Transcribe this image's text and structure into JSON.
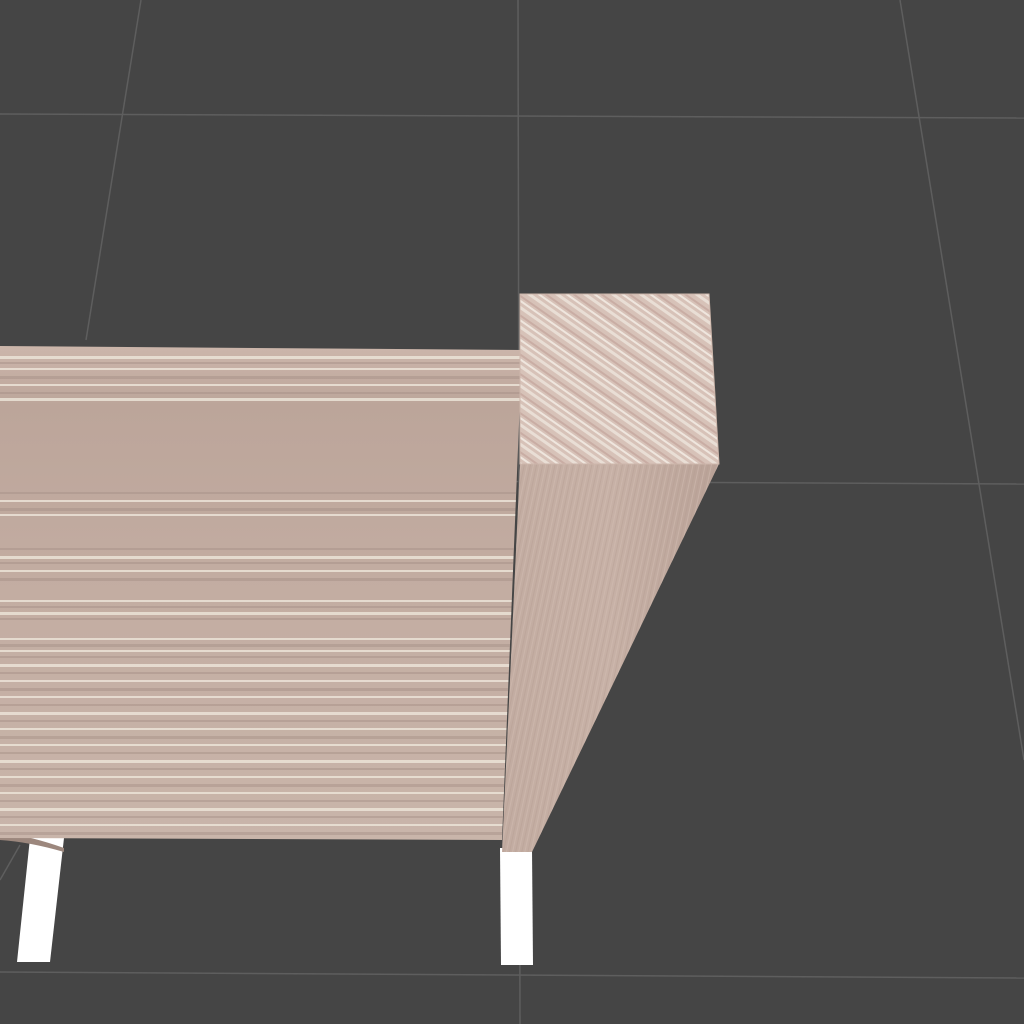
{
  "scene": {
    "colors": {
      "background": "#454545",
      "grid_line": "#5e5e5e",
      "wood_front": "#bfa89d",
      "wood_side": "#c4ada2",
      "wood_top": "#d9c4bb",
      "wood_stripe_light": "#ebe3d7",
      "wood_stripe_dark": "#a58f86",
      "leg": "#ffffff"
    }
  }
}
